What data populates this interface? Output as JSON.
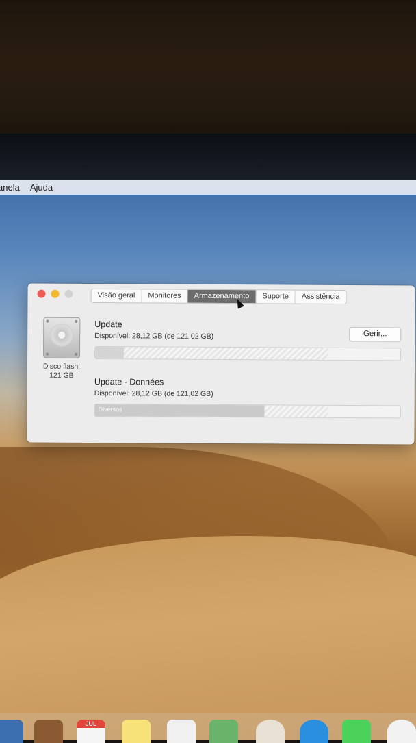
{
  "menubar": {
    "items": [
      "anela",
      "Ajuda"
    ]
  },
  "window": {
    "tabs": [
      "Visão geral",
      "Monitores",
      "Armazenamento",
      "Suporte",
      "Assistência"
    ],
    "active_tab": "Armazenamento",
    "disk": {
      "label_line1": "Disco flash:",
      "label_line2": "121 GB",
      "icon": "hard-drive-icon"
    },
    "manage_button": "Gerir...",
    "volumes": [
      {
        "name": "Update",
        "available": "Disponível: 28,12 GB (de 121,02 GB)",
        "used_fraction": 0.095,
        "purgeable_fraction": 0.67,
        "segment_label": ""
      },
      {
        "name": "Update - Données",
        "available": "Disponível: 28,12 GB (de 121,02 GB)",
        "used_fraction": 0.555,
        "purgeable_fraction": 0.21,
        "segment_label": "Diversos"
      }
    ]
  },
  "colors": {
    "active_tab": "#6c6c6c",
    "close": "#ee5b52",
    "minimize": "#f2bb2f",
    "zoom_disabled": "#d2d2d2"
  },
  "dock": {
    "calendar_month": "JUL"
  }
}
